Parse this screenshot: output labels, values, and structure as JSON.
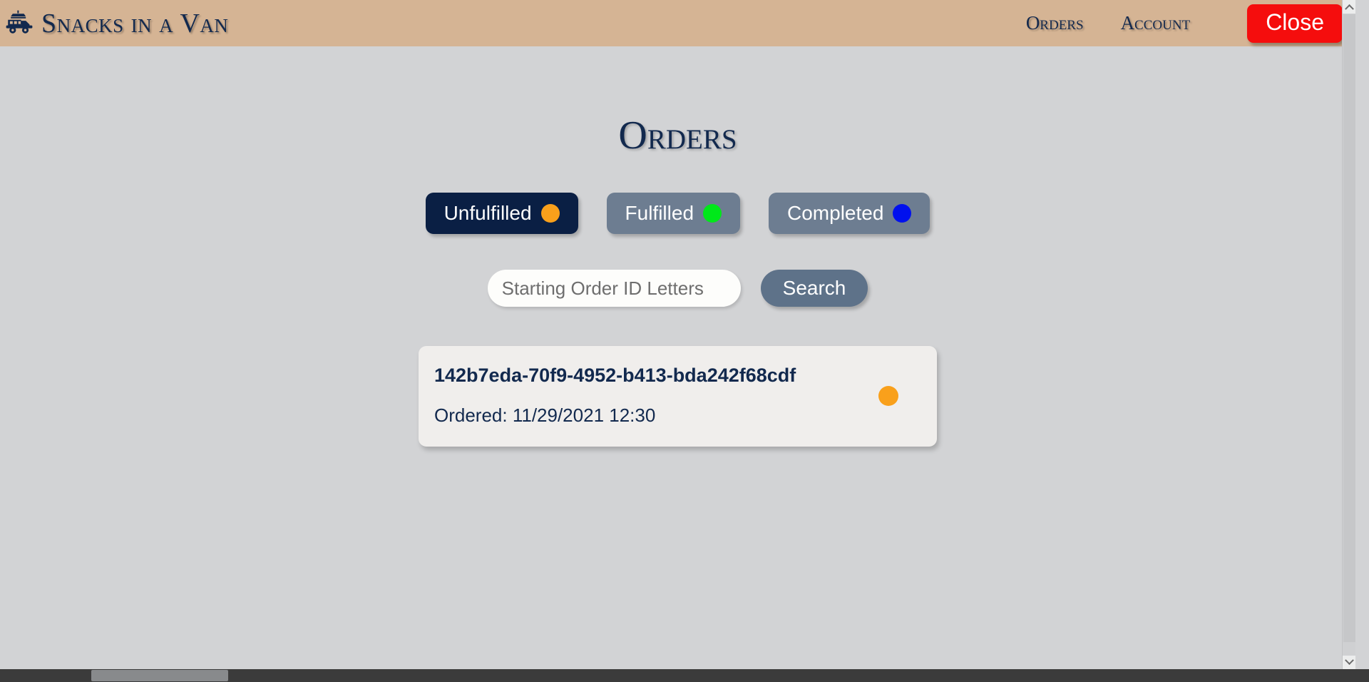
{
  "header": {
    "brand_icon": "food-truck-icon",
    "brand_name": "Snacks in a Van",
    "nav": [
      {
        "label": "Orders",
        "name": "nav-link-orders"
      },
      {
        "label": "Account",
        "name": "nav-link-account"
      }
    ],
    "close_label": "Close",
    "background_color": "#d5b494",
    "close_color": "#f50d0d"
  },
  "main": {
    "page_title": "Orders",
    "filters": [
      {
        "label": "Unfulfilled",
        "dot_color": "#f9a01b",
        "active": true
      },
      {
        "label": "Fulfilled",
        "dot_color": "#00e81a",
        "active": false
      },
      {
        "label": "Completed",
        "dot_color": "#0010ee",
        "active": false
      }
    ],
    "search": {
      "placeholder": "Starting Order ID Letters",
      "value": "",
      "button_label": "Search"
    },
    "orders": [
      {
        "id": "142b7eda-70f9-4952-b413-bda242f68cdf",
        "ordered_label": "Ordered: 11/29/2021 12:30",
        "status_color": "#f9a01b"
      }
    ]
  },
  "theme": {
    "body_background": "#d2d3d5",
    "navy": "#12294e",
    "slate": "#6d7d91",
    "active_tab": "#0a1f44",
    "card_background": "#f0eeec"
  }
}
